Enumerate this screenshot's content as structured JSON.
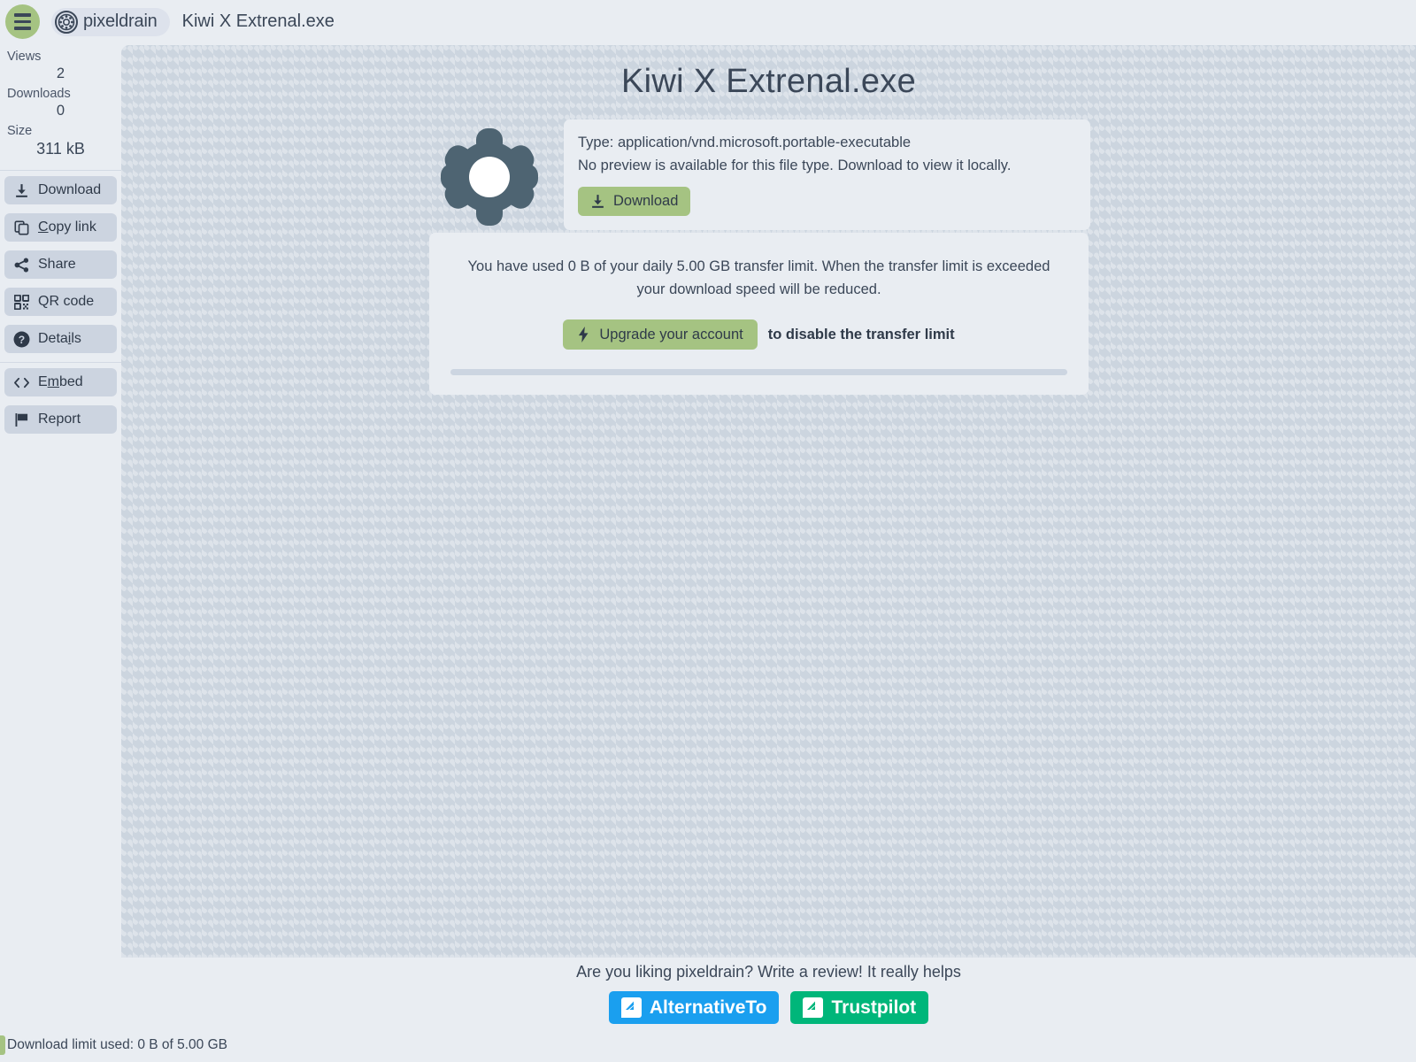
{
  "header": {
    "menu_icon": "hamburger-menu-icon",
    "logo_icon": "pixeldrain-bearing-logo-icon",
    "brand": "pixeldrain",
    "filename": "Kiwi X Extrenal.exe"
  },
  "sidebar": {
    "stats": [
      {
        "label": "Views",
        "value": "2"
      },
      {
        "label": "Downloads",
        "value": "0"
      },
      {
        "label": "Size",
        "value": "311 kB"
      }
    ],
    "actions": [
      {
        "name": "download",
        "icon": "download-icon",
        "label": "Download",
        "accel": ""
      },
      {
        "name": "copy-link",
        "icon": "copy-icon",
        "label": "Copy link",
        "accel": "C"
      },
      {
        "name": "share",
        "icon": "share-icon",
        "label": "Share",
        "accel": ""
      },
      {
        "name": "qr-code",
        "icon": "qr-code-icon",
        "label": "QR code",
        "accel": ""
      },
      {
        "name": "details",
        "icon": "question-mark-circle-icon",
        "label": "Details",
        "accel": "i"
      }
    ],
    "secondary_actions": [
      {
        "name": "embed",
        "icon": "code-brackets-icon",
        "label": "Embed",
        "accel": "m"
      },
      {
        "name": "report",
        "icon": "flag-icon",
        "label": "Report",
        "accel": ""
      }
    ]
  },
  "main": {
    "title": "Kiwi X Extrenal.exe",
    "file_icon": "gear-icon",
    "type_line": "Type: application/vnd.microsoft.portable-executable",
    "no_preview_line": "No preview is available for this file type. Download to view it locally.",
    "download_button": {
      "icon": "download-icon",
      "label": "Download"
    },
    "transfer_notice": "You have used 0 B of your daily 5.00 GB transfer limit. When the transfer limit is exceeded your download speed will be reduced.",
    "upgrade_button": {
      "icon": "lightning-bolt-icon",
      "label": "Upgrade your account"
    },
    "upgrade_note": "to disable the transfer limit"
  },
  "footer": {
    "prompt": "Are you liking pixeldrain? Write a review! It really helps",
    "buttons": [
      {
        "name": "alternativeto",
        "label": "AlternativeTo",
        "color": "#1a9fef"
      },
      {
        "name": "trustpilot",
        "label": "Trustpilot",
        "color": "#00b67a"
      }
    ]
  },
  "status": {
    "download_limit": "Download limit used: 0 B of 5.00 GB",
    "limit_bar_color": "#a5c382"
  },
  "theme": {
    "accent_green": "#a5c382",
    "panel_bg": "#e9edf2",
    "button_bg": "#ccd4e0",
    "text": "#3b4758",
    "gear_color": "#4e6472",
    "pattern_base": "#ccd5df",
    "pattern_motif": "#dde3ea"
  }
}
